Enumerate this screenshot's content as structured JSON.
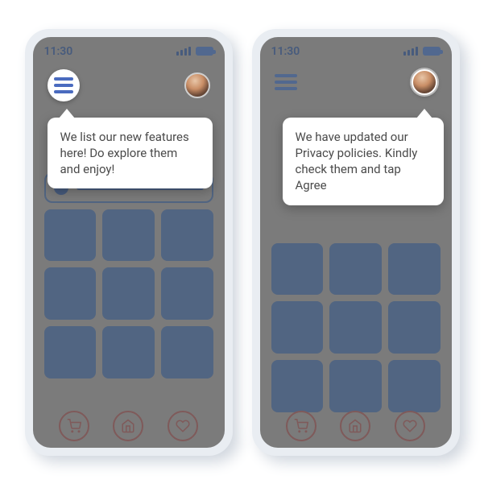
{
  "status": {
    "time": "11:30"
  },
  "phone1": {
    "tooltip": "We list our new features here! Do  explore them and enjoy!"
  },
  "phone2": {
    "tooltip": "We have updated our Privacy policies. Kindly check them and tap Agree"
  }
}
